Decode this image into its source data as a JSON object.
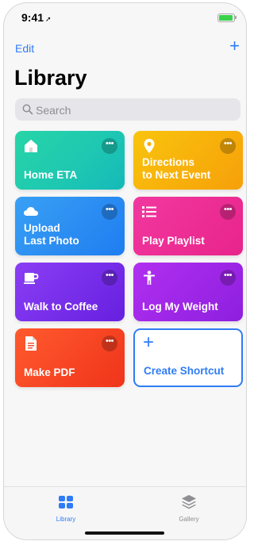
{
  "status": {
    "time": "9:41",
    "location_glyph": "➚"
  },
  "nav": {
    "edit_label": "Edit",
    "add_glyph": "+"
  },
  "header": {
    "title": "Library"
  },
  "search": {
    "placeholder": "Search"
  },
  "shortcuts": [
    {
      "label": "Home ETA",
      "icon": "house-icon",
      "color": "#1fcfaf"
    },
    {
      "label": "Directions\nto Next Event",
      "icon": "map-pin-icon",
      "color": "#f7b10b"
    },
    {
      "label": "Upload\nLast Photo",
      "icon": "cloud-icon",
      "color": "#2b8ef3"
    },
    {
      "label": "Play Playlist",
      "icon": "list-icon",
      "color": "#ec2e95"
    },
    {
      "label": "Walk to Coffee",
      "icon": "coffee-cup-icon",
      "color": "#7a2fea"
    },
    {
      "label": "Log My Weight",
      "icon": "person-icon",
      "color": "#a02ae8"
    },
    {
      "label": "Make PDF",
      "icon": "document-icon",
      "color": "#f84725"
    }
  ],
  "more_glyph": "•••",
  "create": {
    "label": "Create Shortcut",
    "glyph": "+"
  },
  "tabs": [
    {
      "label": "Library",
      "icon": "grid-icon",
      "active": true
    },
    {
      "label": "Gallery",
      "icon": "layers-icon",
      "active": false
    }
  ],
  "colors": {
    "accent": "#2f7cf6",
    "battery": "#39d24a"
  }
}
